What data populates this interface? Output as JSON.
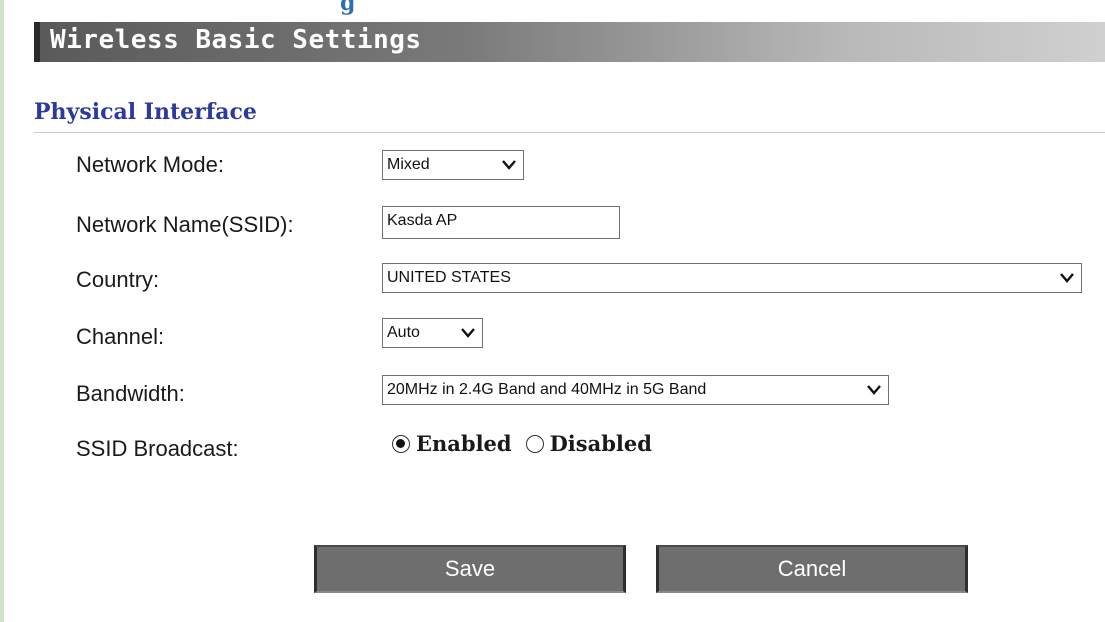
{
  "header_peek": "g",
  "page_title": "Wireless Basic Settings",
  "section_title": "Physical Interface",
  "fields": {
    "network_mode": {
      "label": "Network Mode:",
      "value": "Mixed"
    },
    "ssid": {
      "label": "Network Name(SSID):",
      "value": "Kasda AP"
    },
    "country": {
      "label": "Country:",
      "value": "UNITED STATES"
    },
    "channel": {
      "label": "Channel:",
      "value": "Auto"
    },
    "bandwidth": {
      "label": "Bandwidth:",
      "value": "20MHz in 2.4G Band and 40MHz in 5G Band"
    },
    "ssid_broadcast": {
      "label": "SSID Broadcast:",
      "options": [
        "Enabled",
        "Disabled"
      ],
      "selected": "Enabled"
    }
  },
  "buttons": {
    "save": "Save",
    "cancel": "Cancel"
  },
  "colors": {
    "title_bar_dark": "#5a5a5a",
    "section_title": "#2c3aa0",
    "button_bg": "#6e6e6e"
  }
}
